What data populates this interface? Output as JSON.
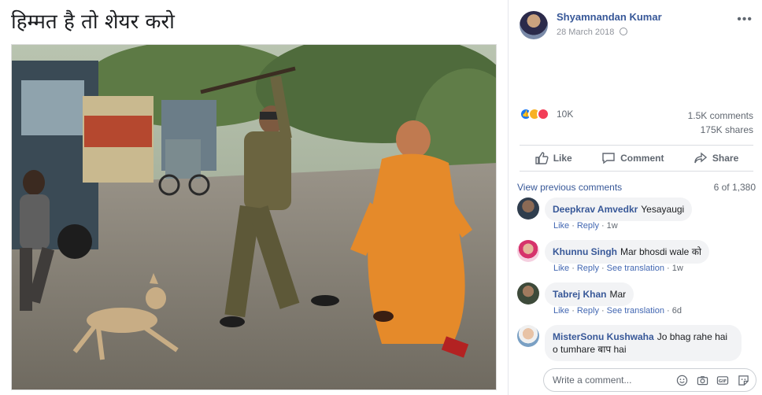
{
  "post": {
    "caption": "हिम्मत है तो शेयर करो",
    "author": "Shyamnandan Kumar",
    "date": "28 March 2018",
    "privacy_icon": "globe-icon",
    "more_icon": "more-options-icon",
    "more_text": "•••"
  },
  "stats": {
    "reactions": "10K",
    "reaction_types": [
      "like",
      "haha",
      "love"
    ],
    "comments": "1.5K comments",
    "shares": "175K shares"
  },
  "actions": {
    "like": "Like",
    "comment": "Comment",
    "share": "Share"
  },
  "comments_section": {
    "view_previous": "View previous comments",
    "count": "6 of 1,380",
    "items": [
      {
        "name": "Deepkrav Amvedkr",
        "text": "Yesayaugi",
        "actions": [
          "Like",
          "Reply"
        ],
        "time": "1w"
      },
      {
        "name": "Khunnu Singh",
        "text": "Mar bhosdi wale को",
        "actions": [
          "Like",
          "Reply",
          "See translation"
        ],
        "time": "1w"
      },
      {
        "name": "Tabrej Khan",
        "text": "Mar",
        "actions": [
          "Like",
          "Reply",
          "See translation"
        ],
        "time": "6d"
      },
      {
        "name": "MisterSonu Kushwaha",
        "text": "Jo bhag rahe hai o tumhare बाप hai",
        "actions": [],
        "time": ""
      }
    ]
  },
  "composer": {
    "placeholder": "Write a comment...",
    "icons": [
      "emoji-icon",
      "camera-icon",
      "gif-icon",
      "sticker-icon"
    ]
  },
  "colors": {
    "link_blue": "#385898",
    "brand_blue": "#1877f2",
    "muted": "#606770",
    "bubble_bg": "#f2f3f5"
  }
}
